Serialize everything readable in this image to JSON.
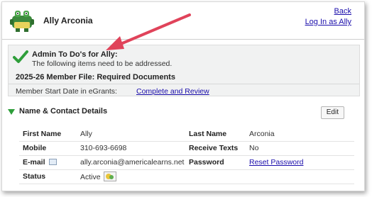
{
  "header": {
    "user_name": "Ally Arconia",
    "back_link": "Back",
    "login_as_link": "Log In as Ally"
  },
  "todo": {
    "title": "Admin To Do's for Ally:",
    "subtitle": "The following items need to be addressed.",
    "section": "2025-26 Member File: Required Documents",
    "items": [
      {
        "label": "Member Start Date in eGrants:",
        "action": "Complete and Review"
      }
    ]
  },
  "contact": {
    "section_title": "Name & Contact Details",
    "edit_label": "Edit",
    "rows": [
      {
        "label1": "First Name",
        "value1": "Ally",
        "label2": "Last Name",
        "value2": "Arconia"
      },
      {
        "label1": "Mobile",
        "value1": "310-693-6698",
        "label2": "Receive Texts",
        "value2": "No"
      },
      {
        "label1": "E-mail",
        "value1": "ally.arconia@americalearns.net",
        "label2": "Password",
        "value2": "Reset Password"
      },
      {
        "label1": "Status",
        "value1": "Active",
        "label2": "",
        "value2": ""
      }
    ]
  },
  "icons": {
    "avatar": "alligator-avatar-icon",
    "check": "green-check-icon",
    "triangle": "triangle-down-icon",
    "email": "email-icon",
    "status": "status-icon"
  },
  "colors": {
    "link": "#1a0dab",
    "check_green": "#2e9e3a",
    "arrow_red": "#e0435a",
    "todo_bg": "#f1f2f2"
  }
}
